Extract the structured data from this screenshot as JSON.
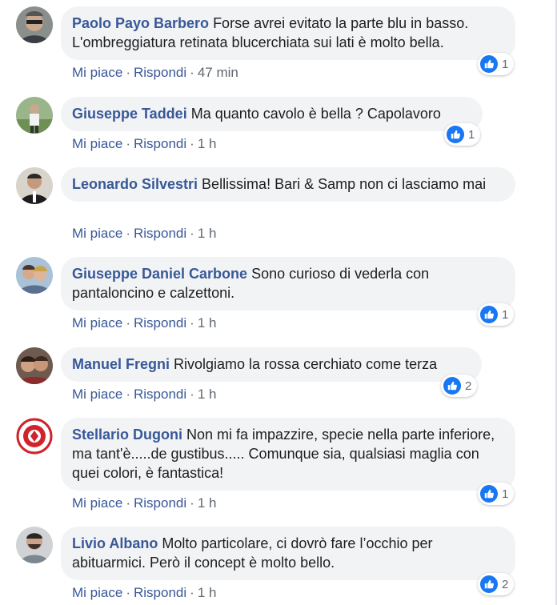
{
  "comments": [
    {
      "author": "Paolo Payo Barbero",
      "text": "Forse avrei evitato la parte blu in basso. L'ombreggiatura retinata blucerchiata sui lati è molto bella.",
      "like_count": "1",
      "like_label": "Mi piace",
      "reply_label": "Rispondi",
      "time": "47 min"
    },
    {
      "author": "Giuseppe Taddei",
      "text": "Ma quanto cavolo è bella ? Capolavoro",
      "like_count": "1",
      "like_label": "Mi piace",
      "reply_label": "Rispondi",
      "time": "1 h"
    },
    {
      "author": "Leonardo Silvestri",
      "text": "Bellissima! Bari & Samp non ci lasciamo mai",
      "like_count": "",
      "like_label": "Mi piace",
      "reply_label": "Rispondi",
      "time": "1 h"
    },
    {
      "author": "Giuseppe Daniel Carbone",
      "text": "Sono curioso di vederla con pantaloncino e calzettoni.",
      "like_count": "1",
      "like_label": "Mi piace",
      "reply_label": "Rispondi",
      "time": "1 h"
    },
    {
      "author": "Manuel Fregni",
      "text": "Rivolgiamo la rossa cerchiato come terza",
      "like_count": "2",
      "like_label": "Mi piace",
      "reply_label": "Rispondi",
      "time": "1 h"
    },
    {
      "author": "Stellario Dugoni",
      "text": "Non mi fa impazzire, specie nella parte inferiore, ma tant'è.....de gustibus..... Comunque sia, qualsiasi maglia con quei colori, è fantastica!",
      "like_count": "1",
      "like_label": "Mi piace",
      "reply_label": "Rispondi",
      "time": "1 h"
    },
    {
      "author": "Livio Albano",
      "text": "Molto particolare, ci dovrò fare l’occhio per abituarmici. Però il concept è molto bello.",
      "like_count": "2",
      "like_label": "Mi piace",
      "reply_label": "Rispondi",
      "time": "1 h"
    }
  ],
  "colors": {
    "author": "#385898",
    "bubble": "#f2f3f5",
    "like_badge": "#1877f2",
    "meta": "#606770"
  }
}
